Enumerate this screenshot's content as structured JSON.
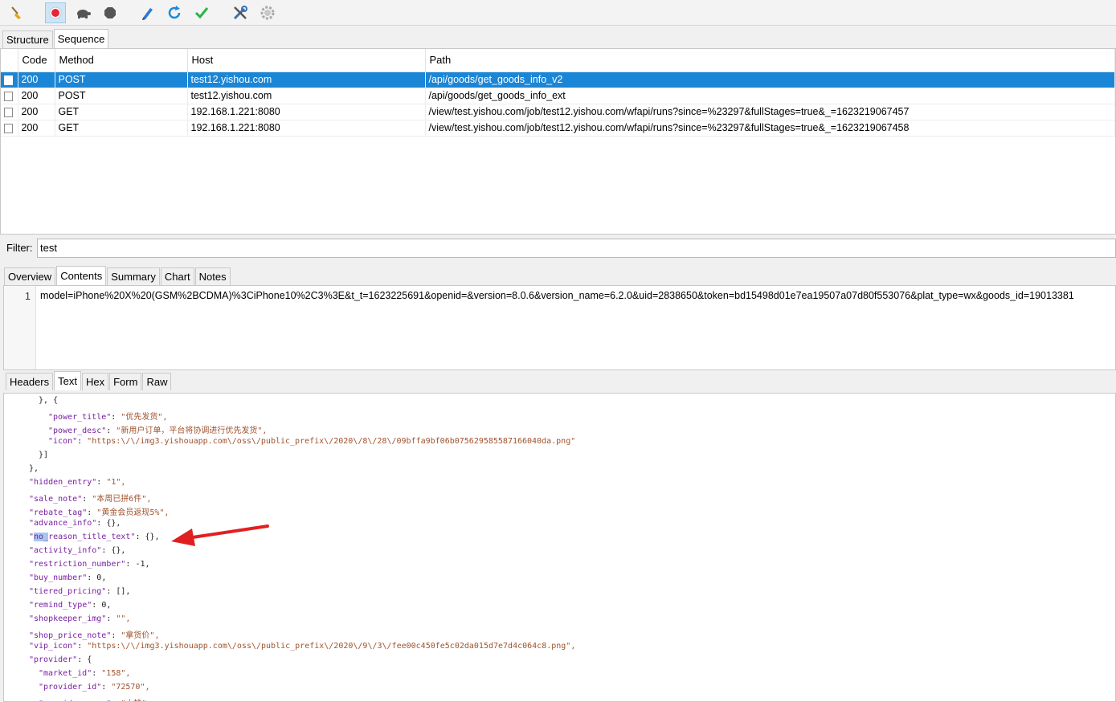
{
  "toolbar": {
    "buttons": [
      {
        "name": "broom-icon",
        "color": "#e0a820"
      },
      {
        "name": "record-icon",
        "color": "#e8243c"
      },
      {
        "name": "turtle-icon",
        "color": "#555555"
      },
      {
        "name": "stop-hexagon-icon",
        "color": "#555555"
      },
      {
        "name": "pen-icon",
        "color": "#2a7ad8"
      },
      {
        "name": "refresh-icon",
        "color": "#1a8ad8"
      },
      {
        "name": "check-icon",
        "color": "#2ab34a"
      },
      {
        "name": "tools-icon",
        "color": "#3a6fb0"
      },
      {
        "name": "settings-gear-icon",
        "color": "#a8a8a8"
      }
    ]
  },
  "top_tabs": [
    {
      "label": "Structure"
    },
    {
      "label": "Sequence"
    }
  ],
  "requests": {
    "columns": [
      "Code",
      "Method",
      "Host",
      "Path"
    ],
    "rows": [
      {
        "code": "200",
        "method": "POST",
        "host": "test12.yishou.com",
        "path": "/api/goods/get_goods_info_v2",
        "selected": true
      },
      {
        "code": "200",
        "method": "POST",
        "host": "test12.yishou.com",
        "path": "/api/goods/get_goods_info_ext",
        "selected": false
      },
      {
        "code": "200",
        "method": "GET",
        "host": "192.168.1.221:8080",
        "path": "/view/test.yishou.com/job/test12.yishou.com/wfapi/runs?since=%23297&fullStages=true&_=1623219067457",
        "selected": false
      },
      {
        "code": "200",
        "method": "GET",
        "host": "192.168.1.221:8080",
        "path": "/view/test.yishou.com/job/test12.yishou.com/wfapi/runs?since=%23297&fullStages=true&_=1623219067458",
        "selected": false
      }
    ]
  },
  "filter": {
    "label": "Filter:",
    "value": "test"
  },
  "detail_tabs": [
    {
      "label": "Overview"
    },
    {
      "label": "Contents"
    },
    {
      "label": "Summary"
    },
    {
      "label": "Chart"
    },
    {
      "label": "Notes"
    }
  ],
  "request_body": {
    "line_number": "1",
    "text": "model=iPhone%20X%20(GSM%2BCDMA)%3CiPhone10%2C3%3E&t_t=1623225691&openid=&version=8.0.6&version_name=6.2.0&uid=2838650&token=bd15498d01e7ea19507a07d80f553076&plat_type=wx&goods_id=19013381"
  },
  "response_tabs": [
    {
      "label": "Headers"
    },
    {
      "label": "Text"
    },
    {
      "label": "Hex"
    },
    {
      "label": "Form"
    },
    {
      "label": "Raw"
    }
  ],
  "response_lines": [
    {
      "indent": 2,
      "text": "}, {"
    },
    {
      "indent": 3,
      "key": "\"power_title\"",
      "value": "\"优先发货\","
    },
    {
      "indent": 3,
      "key": "\"power_desc\"",
      "value": "\"新用户订单，平台将协调进行优先发货\","
    },
    {
      "indent": 3,
      "key": "\"icon\"",
      "value": "\"https:\\/\\/img3.yishouapp.com\\/oss\\/public_prefix\\/2020\\/8\\/28\\/09bffa9bf06b075629585587166040da.png\""
    },
    {
      "indent": 2,
      "text": "}]"
    },
    {
      "indent": 1,
      "text": "},"
    },
    {
      "indent": 1,
      "key": "\"hidden_entry\"",
      "value": "\"1\","
    },
    {
      "indent": 1,
      "key": "\"sale_note\"",
      "value": "\"本周已拼6件\","
    },
    {
      "indent": 1,
      "key": "\"rebate_tag\"",
      "value": "\"黄金会员返现5%\","
    },
    {
      "indent": 1,
      "key": "\"advance_info\"",
      "value": "{},"
    },
    {
      "indent": 1,
      "key": "\"no_reason_title_text\"",
      "value": "{},",
      "highlight": "no_"
    },
    {
      "indent": 1,
      "key": "\"activity_info\"",
      "value": "{},"
    },
    {
      "indent": 1,
      "key": "\"restriction_number\"",
      "value": "-1,"
    },
    {
      "indent": 1,
      "key": "\"buy_number\"",
      "value": "0,"
    },
    {
      "indent": 1,
      "key": "\"tiered_pricing\"",
      "value": "[],"
    },
    {
      "indent": 1,
      "key": "\"remind_type\"",
      "value": "0,"
    },
    {
      "indent": 1,
      "key": "\"shopkeeper_img\"",
      "value": "\"\","
    },
    {
      "indent": 1,
      "key": "\"shop_price_note\"",
      "value": "\"拿货价\","
    },
    {
      "indent": 1,
      "key": "\"vip_icon\"",
      "value": "\"https:\\/\\/img3.yishouapp.com\\/oss\\/public_prefix\\/2020\\/9\\/3\\/fee00c450fe5c02da015d7e7d4c064c8.png\","
    },
    {
      "indent": 1,
      "key": "\"provider\"",
      "value": "{"
    },
    {
      "indent": 2,
      "key": "\"market_id\"",
      "value": "\"158\","
    },
    {
      "indent": 2,
      "key": "\"provider_id\"",
      "value": "\"72570\","
    },
    {
      "indent": 2,
      "key": "\"provider_name\"",
      "value": "\"大桔\","
    }
  ],
  "annotation": {
    "type": "arrow",
    "color": "#e02020"
  }
}
